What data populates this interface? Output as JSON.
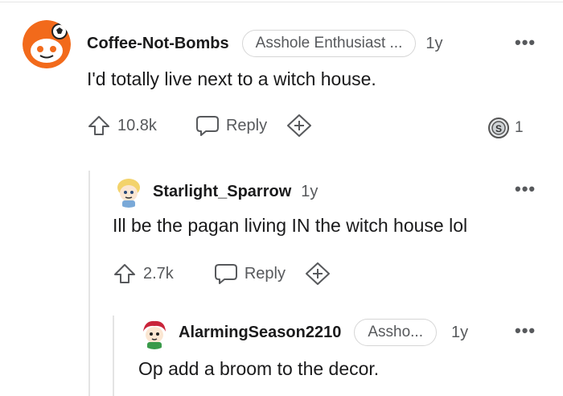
{
  "comments": [
    {
      "username": "Coffee-Not-Bombs",
      "flair": "Asshole Enthusiast ...",
      "age": "1y",
      "text": "I'd totally live next to a witch house.",
      "upvotes": "10.8k",
      "reply_label": "Reply",
      "award_count": "1",
      "award_icon": "silver-coin-icon"
    },
    {
      "username": "Starlight_Sparrow",
      "age": "1y",
      "text": "Ill be the pagan living IN the witch house lol",
      "upvotes": "2.7k",
      "reply_label": "Reply"
    },
    {
      "username": "AlarmingSeason2210",
      "flair": "Assho...",
      "age": "1y",
      "text": "Op add a broom to the decor."
    }
  ],
  "icons": {
    "more": "more-options-icon",
    "upvote": "upvote-arrow-icon",
    "reply": "comment-bubble-icon",
    "award": "add-award-icon"
  }
}
